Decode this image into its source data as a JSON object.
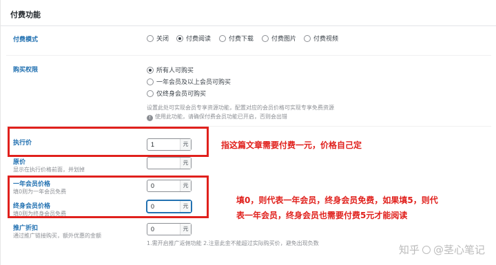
{
  "panel": {
    "title": "付费功能"
  },
  "pay_mode": {
    "label": "付费模式",
    "options": [
      {
        "label": "关闭",
        "checked": false
      },
      {
        "label": "付费阅读",
        "checked": true
      },
      {
        "label": "付费下载",
        "checked": false
      },
      {
        "label": "付费图片",
        "checked": false
      },
      {
        "label": "付费视频",
        "checked": false
      }
    ]
  },
  "purchase_rights": {
    "label": "购买权限",
    "options": [
      {
        "label": "所有人可购买",
        "checked": true
      },
      {
        "label": "一年会员及以上会员可购买",
        "checked": false
      },
      {
        "label": "仅终身会员可购买",
        "checked": false
      }
    ],
    "hint1": "设置此处可实现会员专享资源功能，配置对应的会员价格可实现专享免费资源",
    "hint2": "使用此功能，请确保付费会员功能已开启，否则会出错"
  },
  "price": {
    "label": "执行价",
    "value": "1",
    "unit": "元"
  },
  "original_price": {
    "label": "原价",
    "help": "显示在执行价格前面，并划掉",
    "value": "",
    "unit": "元"
  },
  "annual_price": {
    "label": "一年会员价格",
    "help": "填0则为一年会员免费",
    "value": "0",
    "unit": "元"
  },
  "lifetime_price": {
    "label": "终身会员价格",
    "help": "填0则为终身会员免费",
    "value": "0",
    "unit": "元"
  },
  "promo": {
    "label": "推广折扣",
    "help": "通过推广链接购买，额外优惠的金额",
    "value": "0",
    "unit": "元",
    "hint": "1.需开启推广返佣功能 2.注意此金不能超过实际购买价，避免出现负数"
  },
  "annotations": {
    "price_note": "指这篇文章需要付费一元，价格自己定",
    "member_note_line1": "填0，则代表一年会员，终身会员免费，如果填5，则代",
    "member_note_line2": "表一年会员，终身会员也需要付费5元才能阅读"
  },
  "watermark": {
    "left": "知乎",
    "right": "@茎心笔记"
  }
}
